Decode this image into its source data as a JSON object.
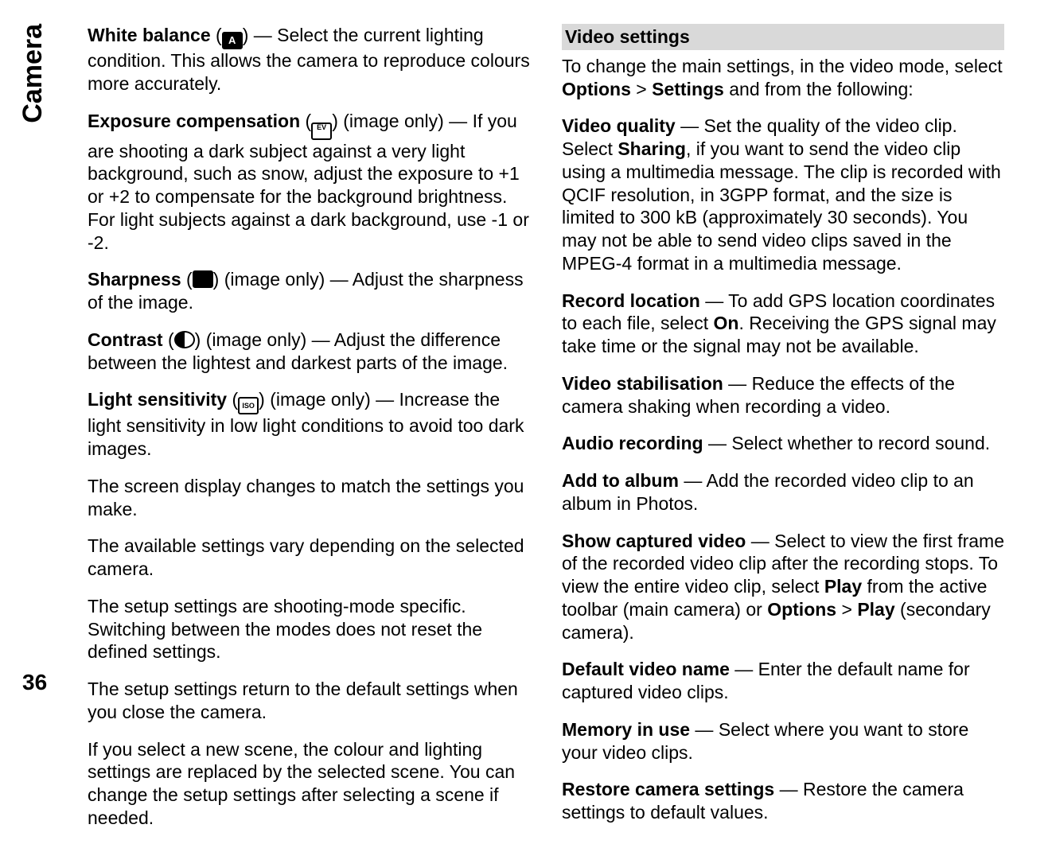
{
  "sidetab": "Camera",
  "page_number": "36",
  "left": {
    "wb_label": "White balance",
    "wb_icon": "A",
    "wb_text": " — Select the current lighting condition. This allows the camera to reproduce colours more accurately.",
    "exp_label": "Exposure compensation",
    "exp_icon": "EV",
    "exp_text": " (image only) — If you are shooting a dark subject against a very light background, such as snow, adjust the exposure to +1 or +2 to compensate for the background brightness. For light subjects against a dark background, use -1 or -2.",
    "sharp_label": "Sharpness",
    "sharp_icon": "",
    "sharp_text": " (image only)  — Adjust the sharpness of the image.",
    "contrast_label": "Contrast",
    "contrast_icon": "",
    "contrast_text": " (image only)  — Adjust the difference between the lightest and darkest parts of the image.",
    "light_label": "Light sensitivity",
    "light_icon": "ISO",
    "light_text": " (image only)  — Increase the light sensitivity in low light conditions to avoid too dark images.",
    "p1": "The screen display changes to match the settings you make.",
    "p2": "The available settings vary depending on the selected camera.",
    "p3": "The setup settings are shooting-mode specific. Switching between the modes does not reset the defined settings.",
    "p4": "The setup settings return to the default settings when you close the camera.",
    "p5": "If you select a new scene, the colour and lighting settings are replaced by the selected scene. You can change the setup settings after selecting a scene if needed."
  },
  "right": {
    "header": "Video settings",
    "intro_pre": "To change the main settings, in the video mode, select ",
    "intro_opt": "Options",
    "intro_gt": " > ",
    "intro_set": "Settings",
    "intro_post": " and from the following:",
    "vq_label": "Video quality",
    "vq_t1": "  — Set the quality of the video clip. Select ",
    "vq_sharing": "Sharing",
    "vq_t2": ", if you want to send the video clip using a multimedia message. The clip is recorded with QCIF resolution, in 3GPP format, and the size is limited to 300 kB (approximately 30 seconds). You may not be able to send video clips saved in the MPEG-4 format in a multimedia message.",
    "rl_label": "Record location",
    "rl_t1": "  — To add GPS location coordinates to each file, select ",
    "rl_on": "On",
    "rl_t2": ". Receiving the GPS signal may take time or the signal may not be available.",
    "vs_label": "Video stabilisation",
    "vs_text": "  — Reduce the effects of the camera shaking when recording a video.",
    "ar_label": "Audio recording",
    "ar_text": "  — Select whether to record sound.",
    "aa_label": "Add to album",
    "aa_text": "  — Add the recorded video clip to an album in Photos.",
    "sc_label": "Show captured video",
    "sc_t1": "  — Select to view the first frame of the recorded video clip after the recording stops. To view the entire video clip, select ",
    "sc_play": "Play",
    "sc_t2": " from the active toolbar (main camera) or ",
    "sc_opt": "Options",
    "sc_gt": " > ",
    "sc_play2": "Play",
    "sc_t3": " (secondary camera).",
    "dvn_label": "Default video name",
    "dvn_text": "  — Enter the default name for captured video clips.",
    "miu_label": "Memory in use",
    "miu_text": "  — Select where you want to store your video clips.",
    "rc_label": "Restore camera settings",
    "rc_text": "  — Restore the camera settings to default values."
  }
}
